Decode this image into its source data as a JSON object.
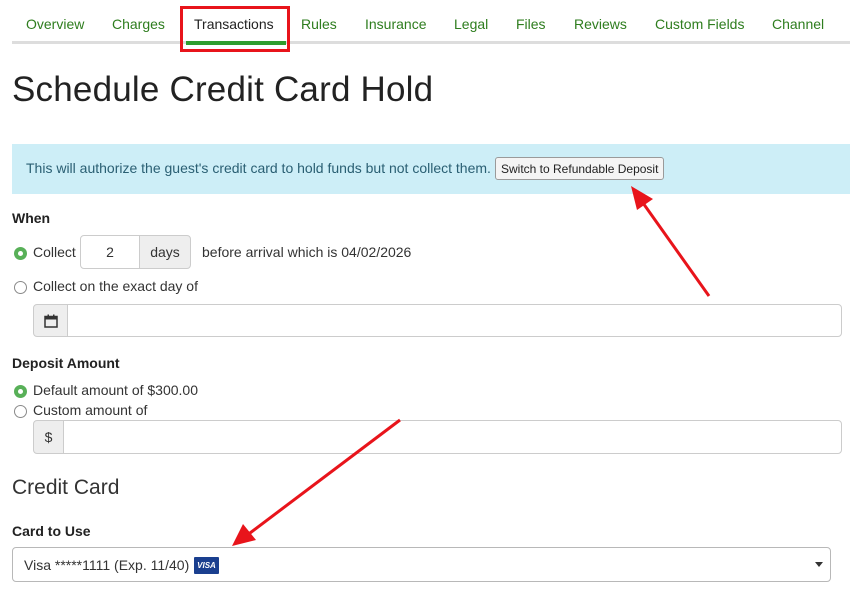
{
  "tabs": [
    {
      "label": "Overview"
    },
    {
      "label": "Charges"
    },
    {
      "label": "Transactions",
      "active": true
    },
    {
      "label": "Rules"
    },
    {
      "label": "Insurance"
    },
    {
      "label": "Legal"
    },
    {
      "label": "Files"
    },
    {
      "label": "Reviews"
    },
    {
      "label": "Custom Fields"
    },
    {
      "label": "Channel"
    }
  ],
  "page": {
    "title": "Schedule Credit Card Hold"
  },
  "info": {
    "text": "This will authorize the guest's credit card to hold funds but not collect them.",
    "switch_button": "Switch to Refundable Deposit"
  },
  "when": {
    "label": "When",
    "collect_label": "Collect",
    "days_value": "2",
    "days_unit": "days",
    "before_text": "before arrival which is 04/02/2026",
    "exact_day_label": "Collect on the exact day of",
    "date_value": "",
    "selected": "collect"
  },
  "deposit": {
    "label": "Deposit Amount",
    "default_label": "Default amount of $300.00",
    "custom_label": "Custom amount of",
    "currency_symbol": "$",
    "custom_value": "",
    "selected": "default"
  },
  "credit_card": {
    "heading": "Credit Card",
    "card_label": "Card to Use",
    "selected_card": "Visa *****1111 (Exp. 11/40)",
    "card_brand": "VISA"
  },
  "annotations": {
    "highlight_color": "#e8141b"
  }
}
